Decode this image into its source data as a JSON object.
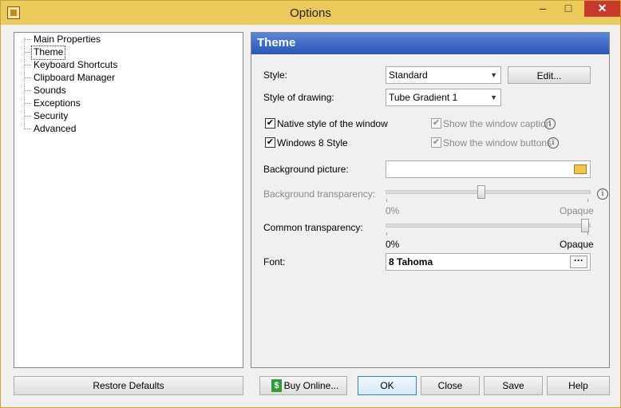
{
  "window": {
    "title": "Options",
    "minimize": "–",
    "maximize": "□",
    "close": "✕"
  },
  "tree": {
    "items": [
      {
        "label": "Main Properties"
      },
      {
        "label": "Theme",
        "selected": true
      },
      {
        "label": "Keyboard Shortcuts"
      },
      {
        "label": "Clipboard Manager"
      },
      {
        "label": "Sounds"
      },
      {
        "label": "Exceptions"
      },
      {
        "label": "Security"
      },
      {
        "label": "Advanced"
      }
    ]
  },
  "panel": {
    "header": "Theme",
    "style_label": "Style:",
    "style_value": "Standard",
    "edit_label": "Edit...",
    "drawing_label": "Style of drawing:",
    "drawing_value": "Tube Gradient 1",
    "native_style_label": "Native style of the window",
    "native_style_checked": true,
    "win8_label": "Windows 8 Style",
    "win8_checked": true,
    "show_caption_label": "Show the window caption",
    "show_caption_checked": true,
    "show_buttons_label": "Show the window buttons",
    "show_buttons_checked": true,
    "bg_picture_label": "Background picture:",
    "bg_picture_value": "",
    "bg_transparency_label": "Background transparency:",
    "bg_transparency_min": "0%",
    "bg_transparency_max": "Opaque",
    "bg_transparency_level": 0.47,
    "common_transparency_label": "Common transparency:",
    "common_transparency_min": "0%",
    "common_transparency_max": "Opaque",
    "common_transparency_level": 1.0,
    "font_label": "Font:",
    "font_value": "8 Tahoma",
    "font_button": "···",
    "check_mark": "✔",
    "info_glyph": "i"
  },
  "footer": {
    "restore_label": "Restore Defaults",
    "buy_label": "Buy Online...",
    "buy_icon_glyph": "$",
    "ok_label": "OK",
    "close_label": "Close",
    "save_label": "Save",
    "help_label": "Help"
  },
  "colors": {
    "titlebar": "#ebc95a",
    "header_gradient_top": "#5a86d6",
    "header_gradient_bottom": "#2a55b6",
    "close_button": "#c7392b"
  }
}
